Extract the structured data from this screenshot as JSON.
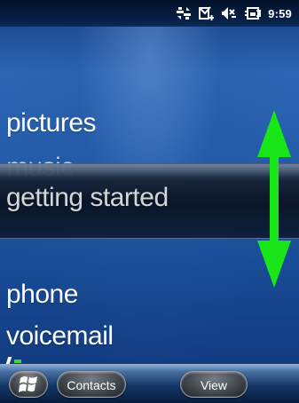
{
  "status_bar": {
    "time": "9:59",
    "icons": [
      "data-sync-icon",
      "message-notification-icon",
      "volume-muted-icon",
      "battery-charging-icon"
    ]
  },
  "menu": {
    "items": [
      {
        "label": "pictures",
        "state": "normal"
      },
      {
        "label": "music",
        "state": "partially-obscured"
      },
      {
        "label": "getting started",
        "state": "selected"
      },
      {
        "label": "phone",
        "state": "normal"
      },
      {
        "label": "voicemail",
        "state": "normal"
      }
    ]
  },
  "gesture_overlay": {
    "icon": "vertical-scroll-arrow-icon",
    "color": "#19e619"
  },
  "bottom_bar": {
    "start_icon": "windows-logo-icon",
    "left_soft_key": "Contacts",
    "right_soft_key": "View"
  },
  "colors": {
    "background": "#225aa8",
    "selection": "#0a1426",
    "arrow": "#19e619"
  }
}
